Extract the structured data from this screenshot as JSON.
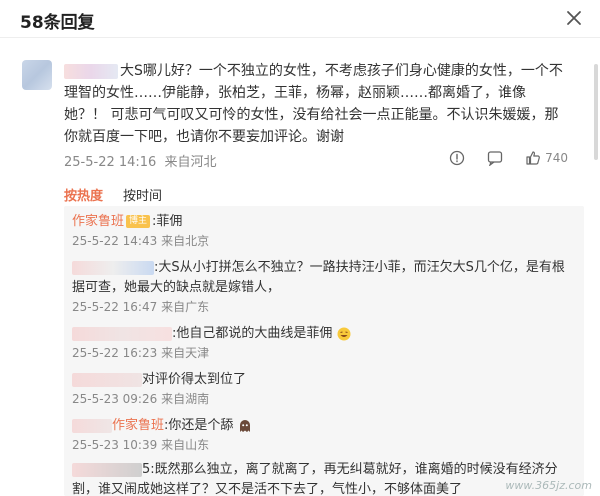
{
  "header": {
    "title": "58条回复"
  },
  "comment": {
    "text_1": "大S哪儿好？一个不独立的女性，不考虑孩子们身心健康的女性，一个不理智的女性……伊能静，张柏芝，王菲，杨幂，赵丽颖……都离婚了，谁像她？！ 可悲可气可叹又可怜的女性，没有给社会一点正能量。不认识朱媛媛，那你就百度一下吧，也请你不要妄加评论。谢谢",
    "time": "25-5-22 14:16",
    "location": "来自河北",
    "likes": "740"
  },
  "sort": {
    "hot": "按热度",
    "time": "按时间"
  },
  "replies": [
    {
      "name": "作家鲁班",
      "badge": "博主",
      "text": ":菲佣",
      "time": "25-5-22 14:43",
      "location": "来自北京"
    },
    {
      "text": ":大S从小打拼怎么不独立？一路扶持汪小菲，而汪欠大S几个亿，是有根据可查，她最大的缺点就是嫁错人，",
      "time": "25-5-22 16:47",
      "location": "来自广东"
    },
    {
      "text": ":他自己都说的大曲线是菲佣",
      "time": "25-5-22 16:23",
      "location": "来自天津"
    },
    {
      "text": "对评价得太到位了",
      "time": "25-5-23 09:26",
      "location": "来自湖南"
    },
    {
      "name": "作家鲁班",
      "text": ":你还是个舔",
      "time": "25-5-23 10:39",
      "location": "来自山东"
    },
    {
      "text": "5:既然那么独立，离了就离了，再无纠葛就好，谁离婚的时候没有经济分割，谁又闹成她这样了？又不是活不下去了，气性小，不够体面美了"
    }
  ],
  "watermark": "www.365jz.com",
  "colors": {
    "accent": "#eb7350",
    "muted": "#888888",
    "reply_bg": "#f6f6f6"
  },
  "icons": [
    "close-icon",
    "share-icon",
    "comment-icon",
    "like-icon",
    "laugh-emoji-icon",
    "ghost-emoji-icon"
  ]
}
